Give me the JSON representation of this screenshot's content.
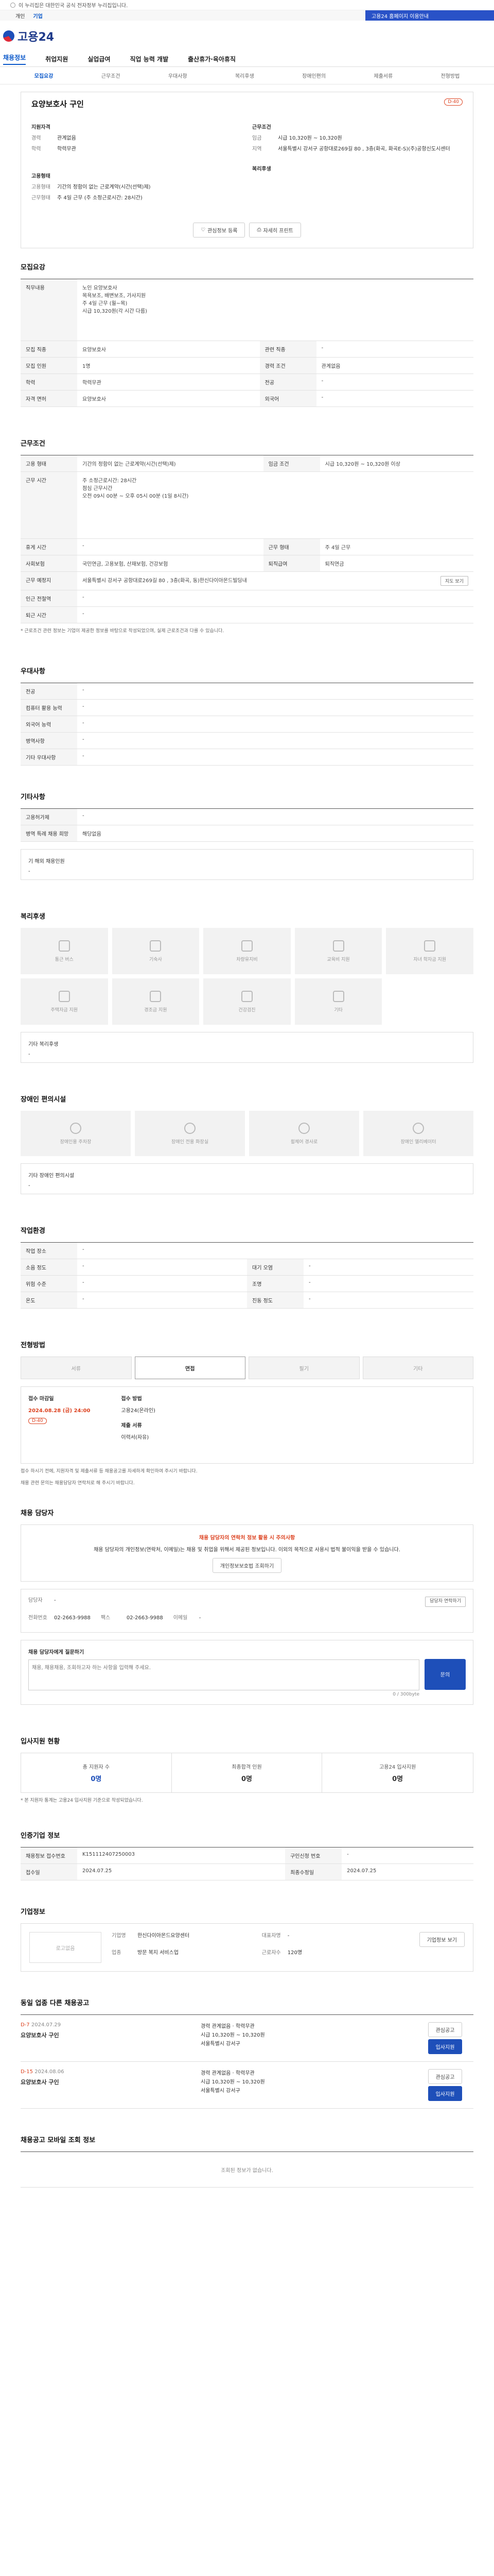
{
  "topbar": {
    "notice": "이 누리집은 대한민국 공식 전자정부 누리집입니다.",
    "links": [
      "개인",
      "기업"
    ],
    "banner": "고용24 홈페이지 이용안내"
  },
  "header": {
    "logo": "고용24"
  },
  "gnb": [
    "채용정보",
    "취업지원",
    "실업급여",
    "직업 능력 개발",
    "출산휴가·육아휴직"
  ],
  "tabs": [
    "모집요강",
    "근무조건",
    "우대사항",
    "복리후생",
    "장애인편의",
    "제출서류",
    "전형방법"
  ],
  "headcard": {
    "corp": "",
    "title": "요양보호사 구인",
    "dday": "D-40",
    "left_title": "지원자격",
    "left": [
      {
        "k": "경력",
        "v": "관계없음"
      },
      {
        "k": "학력",
        "v": "학력무관"
      }
    ],
    "left2_title": "고용형태",
    "left2": [
      {
        "k": "고용형태",
        "v": "기간의 정함이 없는 근로계약(시간(선택)제)"
      },
      {
        "k": "근무형태",
        "v": "주 4일 근무 (주 소정근로시간: 28시간)"
      }
    ],
    "right_title": "근무조건",
    "right": [
      {
        "k": "임금",
        "v": "시급 10,320원 ~ 10,320원"
      },
      {
        "k": "지역",
        "v": "서울특별시 강서구 공항대로269길 80 , 3층(화곡, 화곡E-S)(주)공항신도시센터"
      }
    ],
    "right2_title": "복리후생",
    "btn_apply": "관심정보 등록",
    "btn_print": "자세히 프린트"
  },
  "sections": {
    "recruit": "모집요강",
    "recruit_rows": [
      {
        "k": "직무내용",
        "v": "노인 요양보호사\n목욕보조, 배변보조, 가사지원\n주 4일 근무 (월~목)\n시급 10,320원(각 시간 다름)"
      },
      {
        "k": "모집 직종",
        "v": "요양보호사",
        "k2": "관련 직종",
        "v2": "-"
      },
      {
        "k": "모집 인원",
        "v": "1명",
        "k2": "경력 조건",
        "v2": "관계없음"
      },
      {
        "k": "학력",
        "v": "학력무관",
        "k2": "전공",
        "v2": "-"
      },
      {
        "k": "자격 면허",
        "v": "요양보호사",
        "k2": "외국어",
        "v2": "-"
      }
    ],
    "cond": "근무조건",
    "cond_rows": [
      {
        "k": "고용 형태",
        "v": "기간의 정함이 없는 근로계약(시간(선택)제)",
        "k2": "임금 조건",
        "v2": "시급 10,320원 ~ 10,320원 이상"
      },
      {
        "k": "근무 시간",
        "v": "주 소정근로시간: 28시간\n점심 근무시간\n오전 09시 00분 ~ 오후 05시 00분 (1일 8시간)"
      },
      {
        "k": "휴게 시간",
        "v": "-",
        "k2": "근무 형태",
        "v2": "주 4일 근무"
      },
      {
        "k": "사회보험",
        "v": "국민연금, 고용보험, 산재보험, 건강보험",
        "k2": "퇴직급여",
        "v2": "퇴직연금"
      },
      {
        "k": "근무 예정지",
        "v": "서울특별시 강서구 공항대로269길 80 , 3층(화곡, 동)한신다이아몬드빌딩내",
        "btn": "지도 보기"
      },
      {
        "k": "인근 전철역",
        "v": "-"
      },
      {
        "k": "퇴근 시간",
        "v": "-"
      }
    ],
    "cond_note": "* 근로조건 관련 정보는 기업이 제공한 정보를 바탕으로 작성되었으며, 실제 근로조건과 다를 수 있습니다.",
    "pref": "우대사항",
    "pref_rows": [
      {
        "k": "전공",
        "v": "-"
      },
      {
        "k": "컴퓨터 활용 능력",
        "v": "-"
      },
      {
        "k": "외국어 능력",
        "v": "-"
      },
      {
        "k": "병역사항",
        "v": "-"
      },
      {
        "k": "기타 우대사항",
        "v": "-"
      }
    ],
    "other": "기타사항",
    "other_rows": [
      {
        "k": "고용허가제",
        "v": "-"
      },
      {
        "k": "병역 특례 채용 희망",
        "v": "해당없음"
      }
    ],
    "other_box_title": "기 해외 채용인원",
    "welfare": "복리후생",
    "welfare_items": [
      "통근 버스",
      "기숙사",
      "차량유지비",
      "교육비 지원",
      "자녀 학자금 지원",
      "주택자금 지원",
      "경조금 지원",
      "건강검진",
      "기타"
    ],
    "welfare_extra": "기타 복리후생",
    "disabled": "장애인 편의시설",
    "disabled_items": [
      "장애인용 주차장",
      "장애인 전용 화장실",
      "휠체어 경사로",
      "장애인 엘리베이터"
    ],
    "disabled_extra": "기타 장애인 편의시설",
    "env": "작업환경",
    "env_rows": [
      {
        "k": "작업 장소",
        "v": "-",
        "k2": "",
        "v2": ""
      },
      {
        "k": "소음 정도",
        "v": "-",
        "k2": "대기 오염",
        "v2": "-"
      },
      {
        "k": "위험 수준",
        "v": "-",
        "k2": "조명",
        "v2": "-"
      },
      {
        "k": "온도",
        "v": "-",
        "k2": "진동 정도",
        "v2": "-"
      }
    ],
    "method": "전형방법",
    "method_tabs": [
      "서류",
      "면접",
      "필기",
      "기타"
    ],
    "deadline_label": "접수 마감일",
    "deadline": "2024.08.28 (금) 24:00",
    "dday_badge": "D-40",
    "how_label": "접수 방법",
    "how": "고용24(온라인)",
    "docs_label": "제출 서류",
    "docs": "이력서(자유)",
    "method_note1": "접수 하시기 전에, 지원자격 및 제출서류 등 채용공고를 자세하게 확인하여 주시기 바랍니다.",
    "method_note2": "채용 관련 문의는 채용담당자 연락처로 해 주시기 바랍니다.",
    "contact": "채용 담당자",
    "warn_title": "채용 담당자의 연락처 정보 활용 시 주의사항",
    "warn_body": "채용 담당자의 개인정보(연락처, 이메일)는 채용 및 취업을 위해서 제공된 정보입니다. 이외의 목적으로 사용시 법적 불이익을 받을 수 있습니다.",
    "warn_btn": "개인정보보호법 조회하기",
    "contact_rows": [
      {
        "k": "담당자",
        "v": "-",
        "btn": "담당자 연락하기"
      },
      {
        "k": "전화번호",
        "v": "02-2663-9988"
      },
      {
        "k": "팩스",
        "v": "02-2663-9988"
      },
      {
        "k": "이메일",
        "v": "-"
      }
    ],
    "inquiry_title": "채용 담당자에게 질문하기",
    "inquiry_placeholder": "채용, 채용채용, 조회하고자 하는 사항을 입력해 주세요.",
    "inquiry_count": "0 / 300byte",
    "inquiry_btn": "문의",
    "stats": "입사지원 현황",
    "stats_items": [
      {
        "lbl": "총 지원자 수",
        "val": "0명"
      },
      {
        "lbl": "최종합격 인원",
        "val": "0명"
      },
      {
        "lbl": "고용24 입사지원",
        "val": "0명"
      }
    ],
    "stats_note": "* 본 지원자 통계는 고용24 입사지원 기준으로 작성되었습니다.",
    "info": "인증기업 정보",
    "info_rows": [
      {
        "k": "채용정보 접수번호",
        "v": "K151112407250003",
        "k2": "구인신청 번호",
        "v2": "-"
      },
      {
        "k": "접수일",
        "v": "2024.07.25",
        "k2": "최종수정일",
        "v2": "2024.07.25"
      }
    ],
    "comp": "기업정보",
    "comp_logo": "로고없음",
    "comp_rows": [
      {
        "k": "기업명",
        "v": "한신다이아몬드요양센터"
      },
      {
        "k": "업종",
        "v": "방문 복지 서비스업"
      },
      {
        "k": "대표자명",
        "v": "-"
      },
      {
        "k": "근로자수",
        "v": "120명"
      }
    ],
    "comp_btn": "기업정보 보기",
    "recent": "동일 업종 다른 채용공고",
    "jobs": [
      {
        "dday": "D-7",
        "date": "2024.07.29",
        "title": "요양보호사 구인",
        "cond": "경력 관계없음 · 학력무관",
        "pay": "시급 10,320원 ~ 10,320원",
        "loc": "서울특별시 강서구"
      },
      {
        "dday": "D-15",
        "date": "2024.08.06",
        "title": "요양보호사 구인",
        "cond": "경력 관계없음 · 학력무관",
        "pay": "시급 10,320원 ~ 10,320원",
        "loc": "서울특별시 강서구"
      }
    ],
    "job_btns": [
      "관심공고",
      "입사지원"
    ],
    "mobile": "채용공고 모바일 조회 정보",
    "mobile_empty": "조회된 정보가 없습니다."
  }
}
